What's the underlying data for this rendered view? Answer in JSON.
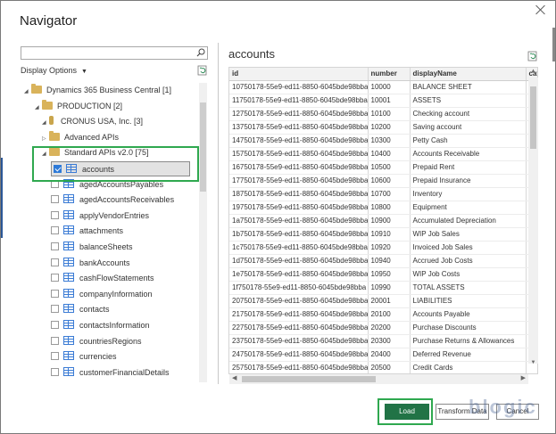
{
  "dialog": {
    "title": "Navigator"
  },
  "left": {
    "search": {
      "value": "",
      "placeholder": ""
    },
    "display_options": "Display Options",
    "tree": [
      {
        "label": "Dynamics 365 Business Central [1]",
        "type": "folder"
      },
      {
        "label": "PRODUCTION [2]",
        "type": "folder"
      },
      {
        "label": "CRONUS USA, Inc. [3]",
        "type": "database"
      },
      {
        "label": "Advanced APIs",
        "type": "folder"
      },
      {
        "label": "Standard APIs v2.0 [75]",
        "type": "folder"
      },
      {
        "label": "accounts",
        "type": "table",
        "checked": true
      },
      {
        "label": "agedAccountsPayables",
        "type": "table",
        "checked": false
      },
      {
        "label": "agedAccountsReceivables",
        "type": "table",
        "checked": false
      },
      {
        "label": "applyVendorEntries",
        "type": "table",
        "checked": false
      },
      {
        "label": "attachments",
        "type": "table",
        "checked": false
      },
      {
        "label": "balanceSheets",
        "type": "table",
        "checked": false
      },
      {
        "label": "bankAccounts",
        "type": "table",
        "checked": false
      },
      {
        "label": "cashFlowStatements",
        "type": "table",
        "checked": false
      },
      {
        "label": "companyInformation",
        "type": "table",
        "checked": false
      },
      {
        "label": "contacts",
        "type": "table",
        "checked": false
      },
      {
        "label": "contactsInformation",
        "type": "table",
        "checked": false
      },
      {
        "label": "countriesRegions",
        "type": "table",
        "checked": false
      },
      {
        "label": "currencies",
        "type": "table",
        "checked": false
      },
      {
        "label": "customerFinancialDetails",
        "type": "table",
        "checked": false
      }
    ]
  },
  "preview": {
    "title": "accounts",
    "columns": [
      "id",
      "number",
      "displayName",
      "cat"
    ],
    "rows": [
      [
        "10750178-55e9-ed11-8850-6045bde98bba",
        "10000",
        "BALANCE SHEET"
      ],
      [
        "11750178-55e9-ed11-8850-6045bde98bba",
        "10001",
        "ASSETS"
      ],
      [
        "12750178-55e9-ed11-8850-6045bde98bba",
        "10100",
        "Checking account"
      ],
      [
        "13750178-55e9-ed11-8850-6045bde98bba",
        "10200",
        "Saving account"
      ],
      [
        "14750178-55e9-ed11-8850-6045bde98bba",
        "10300",
        "Petty Cash"
      ],
      [
        "15750178-55e9-ed11-8850-6045bde98bba",
        "10400",
        "Accounts Receivable"
      ],
      [
        "16750178-55e9-ed11-8850-6045bde98bba",
        "10500",
        "Prepaid Rent"
      ],
      [
        "17750178-55e9-ed11-8850-6045bde98bba",
        "10600",
        "Prepaid Insurance"
      ],
      [
        "18750178-55e9-ed11-8850-6045bde98bba",
        "10700",
        "Inventory"
      ],
      [
        "19750178-55e9-ed11-8850-6045bde98bba",
        "10800",
        "Equipment"
      ],
      [
        "1a750178-55e9-ed11-8850-6045bde98bba",
        "10900",
        "Accumulated Depreciation"
      ],
      [
        "1b750178-55e9-ed11-8850-6045bde98bba",
        "10910",
        "WIP Job Sales"
      ],
      [
        "1c750178-55e9-ed11-8850-6045bde98bba",
        "10920",
        "Invoiced Job Sales"
      ],
      [
        "1d750178-55e9-ed11-8850-6045bde98bba",
        "10940",
        "Accrued Job Costs"
      ],
      [
        "1e750178-55e9-ed11-8850-6045bde98bba",
        "10950",
        "WIP Job Costs"
      ],
      [
        "1f750178-55e9-ed11-8850-6045bde98bba",
        "10990",
        "TOTAL ASSETS"
      ],
      [
        "20750178-55e9-ed11-8850-6045bde98bba",
        "20001",
        "LIABILITIES"
      ],
      [
        "21750178-55e9-ed11-8850-6045bde98bba",
        "20100",
        "Accounts Payable"
      ],
      [
        "22750178-55e9-ed11-8850-6045bde98bba",
        "20200",
        "Purchase Discounts"
      ],
      [
        "23750178-55e9-ed11-8850-6045bde98bba",
        "20300",
        "Purchase Returns & Allowances"
      ],
      [
        "24750178-55e9-ed11-8850-6045bde98bba",
        "20400",
        "Deferred Revenue"
      ],
      [
        "25750178-55e9-ed11-8850-6045bde98bba",
        "20500",
        "Credit Cards"
      ]
    ]
  },
  "footer": {
    "load_label": "Load",
    "transform_label": "Transform Data",
    "cancel_label": "Cancel"
  },
  "colors": {
    "load_button": "#217346",
    "highlight": "#2fa84f",
    "table_icon": "#3a7bd5"
  }
}
